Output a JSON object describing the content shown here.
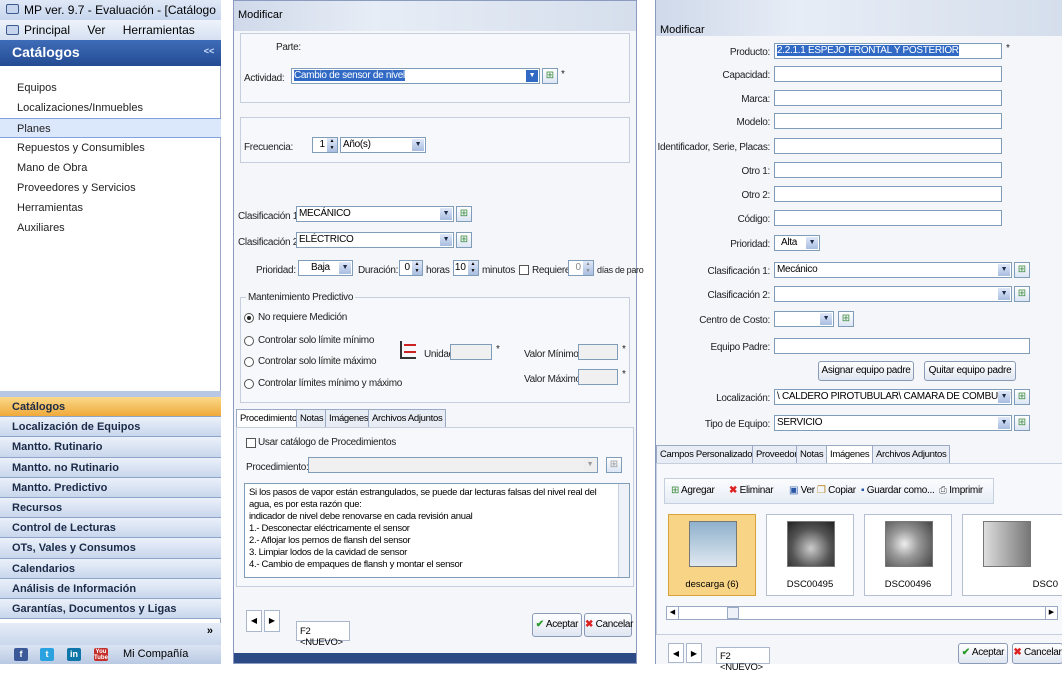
{
  "left": {
    "title": "MP ver. 9.7 - Evaluación - [Catálogo",
    "menu": [
      "Principal",
      "Ver",
      "Herramientas"
    ],
    "section_title": "Catálogos",
    "collapse_glyph": "<<",
    "catalog_items": [
      "Equipos",
      "Localizaciones/Inmuebles",
      "Planes",
      "Repuestos y Consumibles",
      "Mano de Obra",
      "Proveedores y Servicios",
      "Herramientas",
      "Auxiliares"
    ],
    "selected_item": "Planes",
    "nav_buttons": [
      "Catálogos",
      "Localización de Equipos",
      "Mantto. Rutinario",
      "Mantto. no Rutinario",
      "Mantto. Predictivo",
      "Recursos",
      "Control de Lecturas",
      "OTs, Vales y Consumos",
      "Calendarios",
      "Análisis de Información",
      "Garantías, Documentos y Ligas"
    ],
    "active_nav": "Catálogos",
    "more_glyph": "»",
    "social_label": "Mi Compañía",
    "social_icons": [
      "f",
      "t",
      "in",
      "You Tube"
    ]
  },
  "mid": {
    "title": "Modificar",
    "parte_label": "Parte:",
    "actividad_label": "Actividad:",
    "actividad_value": "Cambio de sensor de nivel",
    "required_mark": "*",
    "frecuencia_label": "Frecuencia:",
    "frecuencia_value": "1",
    "frecuencia_unit": "Año(s)",
    "clasif1_label": "Clasificación 1:",
    "clasif1_value": "MECÁNICO",
    "clasif2_label": "Clasificación 2:",
    "clasif2_value": "ELÉCTRICO",
    "prioridad_label": "Prioridad:",
    "prioridad_value": "Baja",
    "duracion_label": "Duración:",
    "horas_value": "0",
    "horas_label": "horas",
    "minutos_value": "10",
    "minutos_label": "minutos",
    "requiere_label": "Requiere",
    "dias_value": "0",
    "dias_label": "días de paro",
    "predictivo_title": "Mantenimiento Predictivo",
    "predictivo_options": [
      "No requiere Medición",
      "Controlar solo límite mínimo",
      "Controlar solo límite máximo",
      "Controlar límites mínimo y máximo"
    ],
    "predictivo_selected": "No requiere Medición",
    "unidad_label": "Unidad:",
    "valor_min_label": "Valor Mínimo:",
    "valor_max_label": "Valor Máximo:",
    "tabs": [
      "Procedimiento",
      "Notas",
      "Imágenes",
      "Archivos Adjuntos"
    ],
    "active_tab": "Procedimiento",
    "usar_catalogo_label": "Usar catálogo de Procedimientos",
    "procedimiento_label": "Procedimiento:",
    "procedure_text": [
      "Si los pasos de vapor están estrangulados, se puede dar lecturas falsas del nivel real del agua, es por esta razón que:",
      "indicador de nivel debe renovarse en cada revisión anual",
      "1.- Desconectar eléctricamente el sensor",
      "2.- Aflojar los pernos de flansh del sensor",
      "3. Limpiar lodos de la cavidad de sensor",
      "4.- Cambio de empaques de flansh y montar el sensor"
    ],
    "nav_prev": "◀",
    "nav_next": "▶",
    "status": "F2 <NUEVO>",
    "aceptar_label": "Aceptar",
    "cancelar_label": "Cancelar"
  },
  "right": {
    "title": "Modificar",
    "fields": [
      {
        "label": "Producto:",
        "value": "2.2.1.1 ESPEJO FRONTAL Y POSTERIOR"
      },
      {
        "label": "Capacidad:",
        "value": ""
      },
      {
        "label": "Marca:",
        "value": ""
      },
      {
        "label": "Modelo:",
        "value": ""
      },
      {
        "label": "Identificador, Serie, Placas:",
        "value": ""
      },
      {
        "label": "Otro 1:",
        "value": ""
      },
      {
        "label": "Otro 2:",
        "value": ""
      },
      {
        "label": "Código:",
        "value": ""
      }
    ],
    "required_mark": "*",
    "prioridad_label": "Prioridad:",
    "prioridad_value": "Alta",
    "clasif1_label": "Clasificación 1:",
    "clasif1_value": "Mecánico",
    "clasif2_label": "Clasificación 2:",
    "clasif2_value": "",
    "centro_label": "Centro de Costo:",
    "centro_value": "",
    "equipo_padre_label": "Equipo Padre:",
    "equipo_padre_value": "",
    "asignar_label": "Asignar equipo padre",
    "quitar_label": "Quitar equipo padre",
    "localizacion_label": "Localización:",
    "localizacion_value": "\\ CALDERO PIROTUBULAR\\ CAMARA DE COMBUSTIÓN",
    "tipo_label": "Tipo de Equipo:",
    "tipo_value": "SERVICIO",
    "tabs": [
      "Campos Personalizados",
      "Proveedor",
      "Notas",
      "Imágenes",
      "Archivos Adjuntos"
    ],
    "active_tab": "Imágenes",
    "toolbar": [
      "Agregar",
      "Eliminar",
      "Ver",
      "Copiar",
      "Guardar como...",
      "Imprimir"
    ],
    "images": [
      "descarga (6)",
      "DSC00495",
      "DSC00496",
      "DSC0"
    ],
    "selected_image": "descarga (6)",
    "nav_prev": "◀",
    "nav_next": "▶",
    "status": "F2 <NUEVO>",
    "aceptar_label": "Aceptar",
    "cancelar_label": "Cancelar"
  },
  "colors": {
    "accent": "#2b59a8",
    "active_nav": "#f2b14a",
    "selection": "#316ac5"
  }
}
